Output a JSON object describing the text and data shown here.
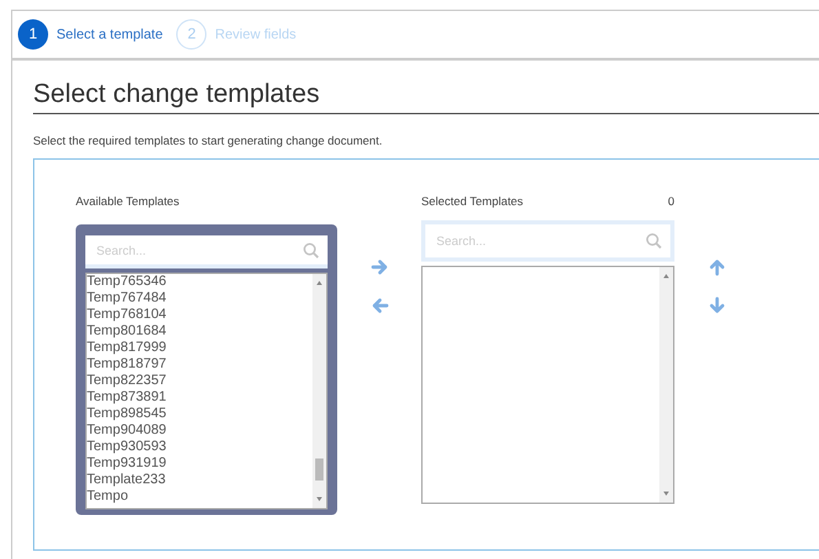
{
  "steps": [
    {
      "number": "1",
      "label": "Select a template",
      "selected": true
    },
    {
      "number": "2",
      "label": "Review fields",
      "selected": false
    }
  ],
  "title": "Select change templates",
  "description": "Select the required templates to start generating change document.",
  "available": {
    "label": "Available Templates",
    "placeholder": "Search...",
    "focused": true,
    "items": [
      "Temp765346",
      "Temp767484",
      "Temp768104",
      "Temp801684",
      "Temp817999",
      "Temp818797",
      "Temp822357",
      "Temp873891",
      "Temp898545",
      "Temp904089",
      "Temp930593",
      "Temp931919",
      "Template233",
      "Tempo"
    ]
  },
  "selected": {
    "label": "Selected Templates",
    "count": "0",
    "placeholder": "Search...",
    "focused": false
  }
}
